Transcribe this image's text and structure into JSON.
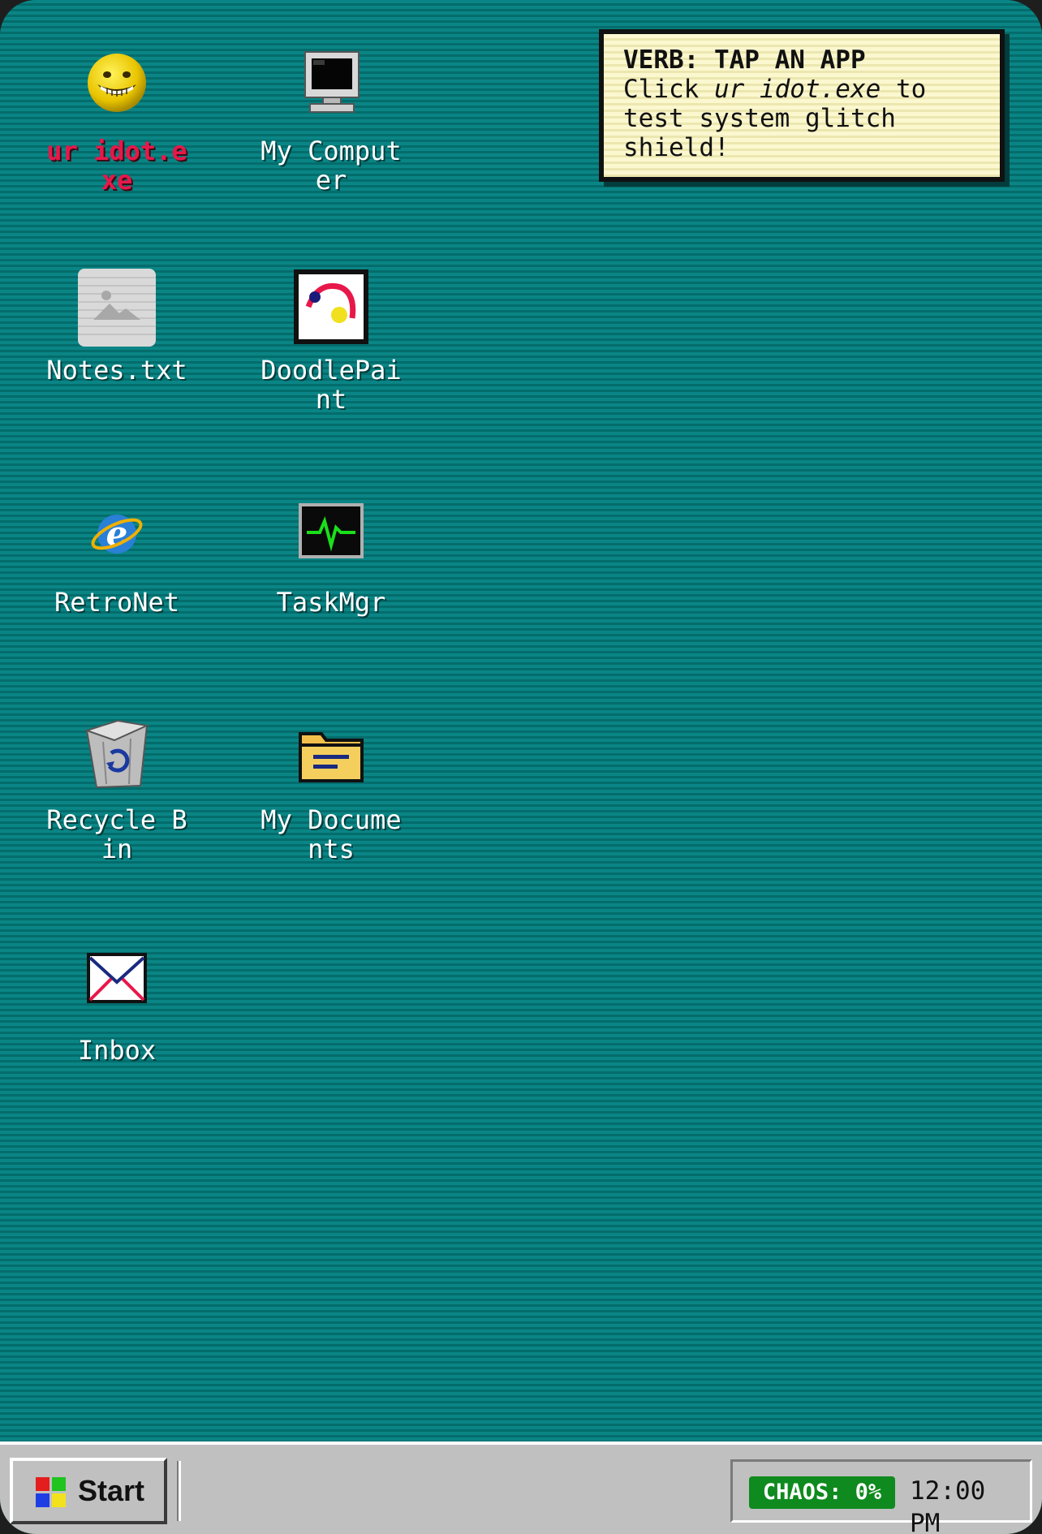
{
  "hint": {
    "title": "VERB: TAP AN APP",
    "body_prefix": "Click ",
    "body_emphasis": "ur idot.exe",
    "body_suffix": " to test system glitch shield!"
  },
  "icons": [
    {
      "label": "ur idot.exe",
      "icon": "smiley-face-icon"
    },
    {
      "label": "My Computer",
      "icon": "computer-monitor-icon"
    },
    {
      "label": "Notes.txt",
      "icon": "image-file-icon"
    },
    {
      "label": "DoodlePaint",
      "icon": "paint-canvas-icon"
    },
    {
      "label": "RetroNet",
      "icon": "browser-globe-icon"
    },
    {
      "label": "TaskMgr",
      "icon": "heartbeat-monitor-icon"
    },
    {
      "label": "Recycle Bin",
      "icon": "recycle-bin-icon"
    },
    {
      "label": "My Documents",
      "icon": "folder-icon"
    },
    {
      "label": "Inbox",
      "icon": "envelope-icon"
    }
  ],
  "taskbar": {
    "start_label": "Start",
    "chaos_label": "CHAOS: 0%",
    "clock": "12:00 PM"
  },
  "colors": {
    "desktop": "#0a8585",
    "danger_label": "#e8174a",
    "chaos_badge": "#0f8a1e",
    "taskbar": "#c0c0c0"
  }
}
